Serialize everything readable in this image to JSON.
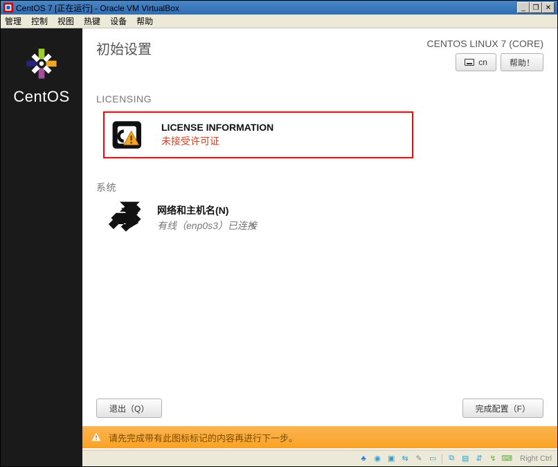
{
  "titlebar": {
    "text": "CentOS 7 [正在运行] - Oracle VM VirtualBox",
    "min": "_",
    "restore": "❐",
    "close": "✕"
  },
  "menu": {
    "items": [
      "管理",
      "控制",
      "视图",
      "热键",
      "设备",
      "帮助"
    ]
  },
  "sidebar": {
    "brand": "CentOS"
  },
  "header": {
    "title": "初始设置",
    "distro": "CENTOS LINUX 7 (CORE)",
    "kb_label": "cn",
    "help_label": "帮助！"
  },
  "sections": {
    "licensing": {
      "label": "LICENSING",
      "spoke_title": "LICENSE INFORMATION",
      "spoke_status": "未接受许可证"
    },
    "system": {
      "label": "系统",
      "spoke_title": "网络和主机名(N)",
      "spoke_status": "有线（enp0s3）已连接"
    }
  },
  "footer": {
    "quit": "退出（Q）",
    "finish": "完成配置（F）"
  },
  "warning_bar": {
    "text": "请先完成带有此图标标记的内容再进行下一步。"
  },
  "status_bar": {
    "right_text": "Right Ctrl"
  }
}
